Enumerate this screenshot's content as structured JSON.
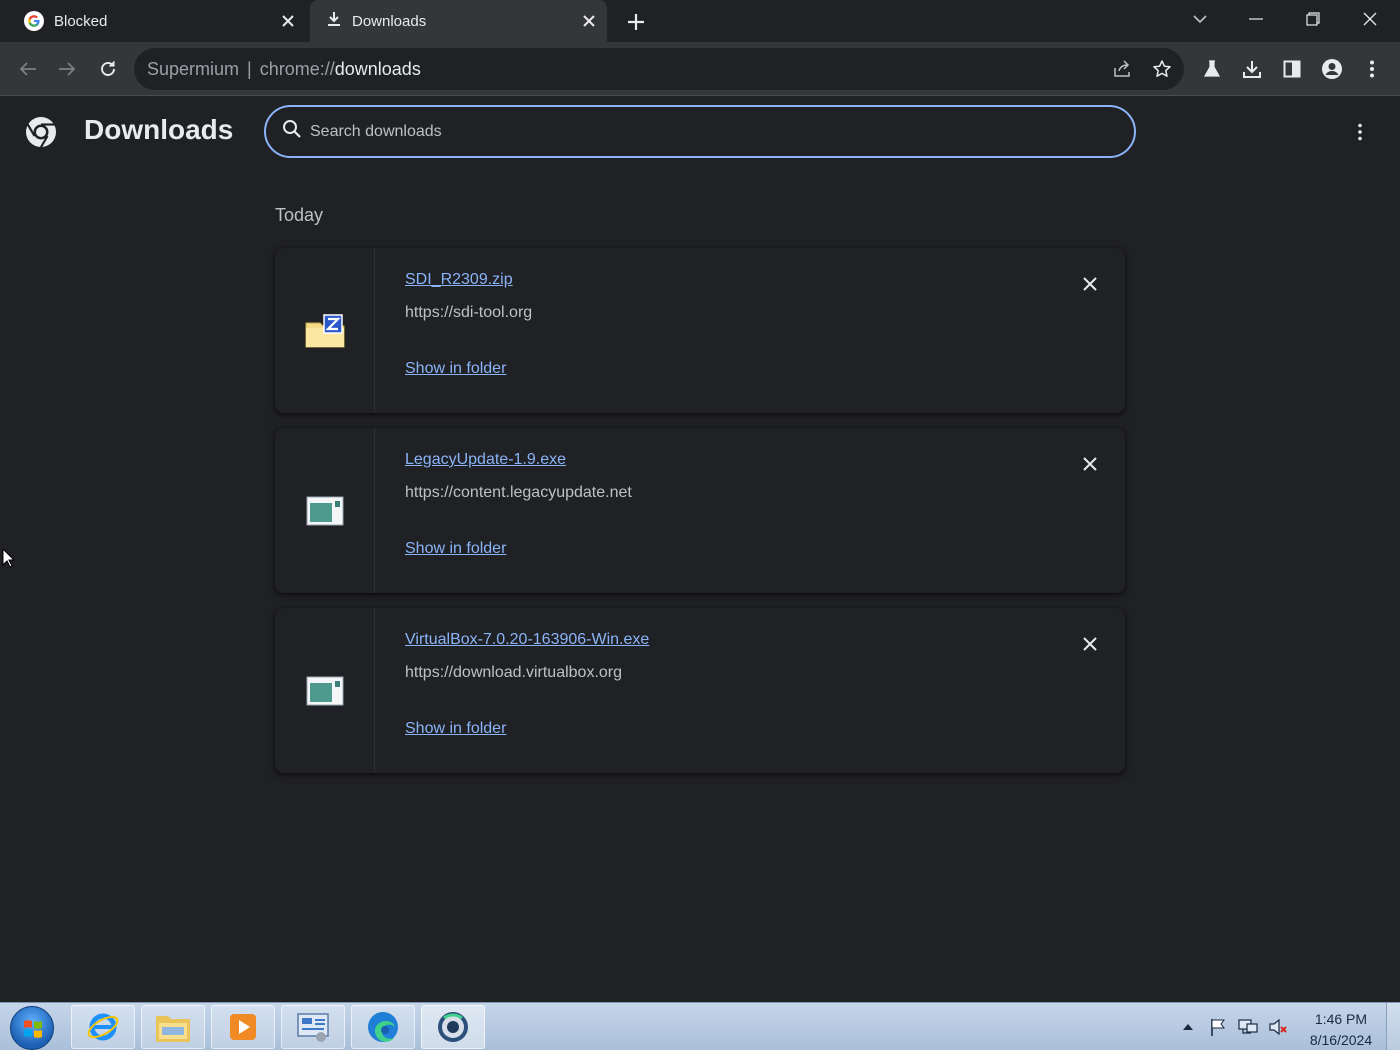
{
  "browser": {
    "tabs": [
      {
        "title": "Blocked",
        "favicon": "google-g-icon",
        "active": false
      },
      {
        "title": "Downloads",
        "favicon": "download-icon",
        "active": true
      }
    ],
    "address": {
      "origin": "Supermium",
      "scheme": "chrome://",
      "path": "downloads"
    }
  },
  "page": {
    "title": "Downloads",
    "search_placeholder": "Search downloads",
    "section_date": "Today",
    "downloads": [
      {
        "filename": "SDI_R2309.zip",
        "url": "https://sdi-tool.org",
        "action": "Show in folder",
        "icon": "zip-folder-icon"
      },
      {
        "filename": "LegacyUpdate-1.9.exe",
        "url": "https://content.legacyupdate.net",
        "action": "Show in folder",
        "icon": "exe-app-icon"
      },
      {
        "filename": "VirtualBox-7.0.20-163906-Win.exe",
        "url": "https://download.virtualbox.org",
        "action": "Show in folder",
        "icon": "exe-app-icon"
      }
    ]
  },
  "taskbar": {
    "apps": [
      "internet-explorer-icon",
      "file-explorer-icon",
      "media-player-icon",
      "control-panel-icon",
      "edge-icon",
      "supermium-icon"
    ],
    "clock_time": "1:46 PM",
    "clock_date": "8/16/2024"
  },
  "colors": {
    "accent": "#8ab4f8",
    "background": "#202124",
    "toolbar": "#35363a"
  }
}
